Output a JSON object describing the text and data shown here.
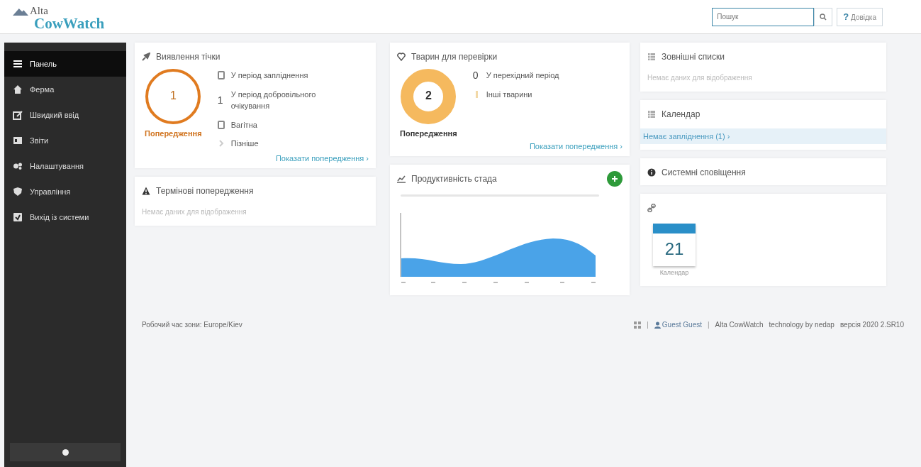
{
  "header": {
    "logo_top": "Alta",
    "logo_bottom": "CowWatch",
    "search": {
      "placeholder": "Пошук"
    },
    "help_button": {
      "mark": "?",
      "label": "Довідка"
    }
  },
  "sidebar": {
    "items": [
      {
        "label": "Панель",
        "selected": true
      },
      {
        "label": "Ферма",
        "selected": false
      },
      {
        "label": "Швидкий ввід",
        "selected": false
      },
      {
        "label": "Звіти",
        "selected": false
      },
      {
        "label": "Налаштування",
        "selected": false
      },
      {
        "label": "Управління",
        "selected": false
      },
      {
        "label": "Вихід із системи",
        "selected": false
      }
    ]
  },
  "heat_card": {
    "title": "Виявлення тічки",
    "gauge": {
      "kind": "ring",
      "value": "1",
      "label": "Попередження"
    },
    "stats": [
      {
        "kind": "icon",
        "label": "У період запліднення"
      },
      {
        "kind": "count",
        "count": "1",
        "label": "У період добровільного очікування"
      },
      {
        "kind": "icon",
        "label": "Вагітна"
      },
      {
        "kind": "chevron",
        "label": "Пізніше"
      }
    ],
    "link": "Показати попередження ›"
  },
  "urgent_card": {
    "title": "Термінові попередження",
    "note": "Немає даних для відображення"
  },
  "check_card": {
    "title": "Тварин для перевірки",
    "gauge": {
      "kind": "donut",
      "value": "2",
      "label": "Попередження"
    },
    "stats": [
      {
        "kind": "count",
        "count": "0",
        "label": "У перехідний період"
      },
      {
        "kind": "bar",
        "label": "Інші тварини"
      }
    ],
    "link": "Показати попередження ›"
  },
  "herd_card": {
    "title": "Продуктивність стада"
  },
  "lists_card": {
    "title": "Зовнішні списки",
    "note": "Немає даних для відображення"
  },
  "calendar_card": {
    "title": "Календар",
    "entries": [
      {
        "label": "Немає запліднення (1) ›",
        "selected": true
      }
    ]
  },
  "notify_card": {
    "title": "Системні сповіщення"
  },
  "links_card": {
    "tiles": [
      {
        "day": "21",
        "label": "Календар"
      }
    ]
  },
  "footer": {
    "timezone": "Робочий час зони: Europe/Kiev",
    "user": "Guest Guest",
    "product": "Alta CowWatch",
    "vendor": "technology by nedap",
    "version": "версія 2020 2.SR10",
    "separators": [
      "|",
      "|"
    ]
  }
}
